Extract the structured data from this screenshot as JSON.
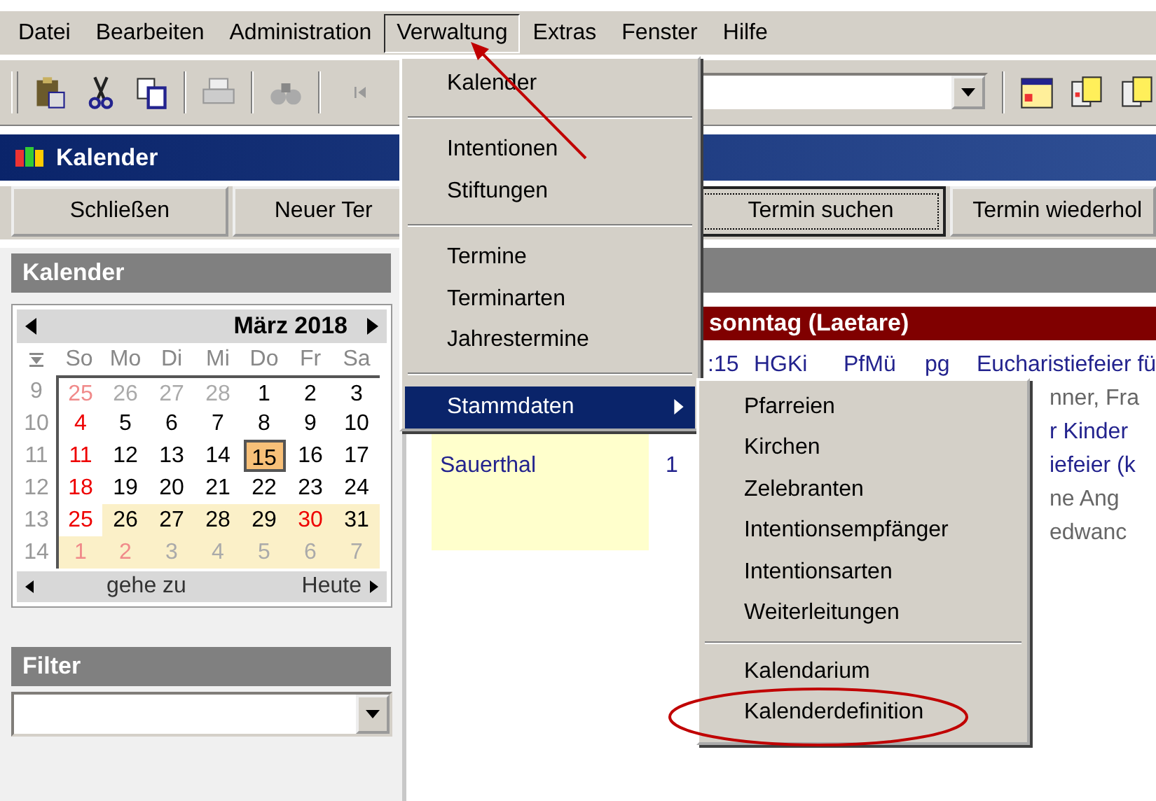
{
  "menubar": [
    {
      "label": "Datei",
      "selected": false
    },
    {
      "label": "Bearbeiten",
      "selected": false
    },
    {
      "label": "Administration",
      "selected": false
    },
    {
      "label": "Verwaltung",
      "selected": true
    },
    {
      "label": "Extras",
      "selected": false
    },
    {
      "label": "Fenster",
      "selected": false
    },
    {
      "label": "Hilfe",
      "selected": false
    }
  ],
  "window": {
    "title": "Kalender"
  },
  "buttons": [
    {
      "label": "Schließen",
      "focused": false
    },
    {
      "label": "Neuer Ter",
      "focused": false
    },
    {
      "label": "Termin suchen",
      "focused": true
    },
    {
      "label": "Termin wiederhol",
      "focused": false
    }
  ],
  "calendar_panel": {
    "title": "Kalender",
    "month": "März 2018",
    "weekdays": [
      "So",
      "Mo",
      "Di",
      "Mi",
      "Do",
      "Fr",
      "Sa"
    ],
    "weeks": [
      {
        "week": "9",
        "days": [
          {
            "text": "25",
            "kind": "sunday",
            "muted": true,
            "marked": false,
            "selected": false
          },
          {
            "text": "26",
            "kind": "weekday",
            "muted": true,
            "marked": false,
            "selected": false
          },
          {
            "text": "27",
            "kind": "weekday",
            "muted": true,
            "marked": false,
            "selected": false
          },
          {
            "text": "28",
            "kind": "weekday",
            "muted": true,
            "marked": false,
            "selected": false
          },
          {
            "text": "1",
            "kind": "weekday",
            "muted": false,
            "marked": false,
            "selected": false
          },
          {
            "text": "2",
            "kind": "weekday",
            "muted": false,
            "marked": false,
            "selected": false
          },
          {
            "text": "3",
            "kind": "weekday",
            "muted": false,
            "marked": false,
            "selected": false
          }
        ]
      },
      {
        "week": "10",
        "days": [
          {
            "text": "4",
            "kind": "sunday",
            "muted": false,
            "marked": false,
            "selected": false
          },
          {
            "text": "5",
            "kind": "weekday",
            "muted": false,
            "marked": false,
            "selected": false
          },
          {
            "text": "6",
            "kind": "weekday",
            "muted": false,
            "marked": false,
            "selected": false
          },
          {
            "text": "7",
            "kind": "weekday",
            "muted": false,
            "marked": false,
            "selected": false
          },
          {
            "text": "8",
            "kind": "weekday",
            "muted": false,
            "marked": false,
            "selected": false
          },
          {
            "text": "9",
            "kind": "weekday",
            "muted": false,
            "marked": false,
            "selected": false
          },
          {
            "text": "10",
            "kind": "weekday",
            "muted": false,
            "marked": false,
            "selected": false
          }
        ]
      },
      {
        "week": "11",
        "days": [
          {
            "text": "11",
            "kind": "sunday",
            "muted": false,
            "marked": false,
            "selected": false
          },
          {
            "text": "12",
            "kind": "weekday",
            "muted": false,
            "marked": false,
            "selected": false
          },
          {
            "text": "13",
            "kind": "weekday",
            "muted": false,
            "marked": false,
            "selected": false
          },
          {
            "text": "14",
            "kind": "weekday",
            "muted": false,
            "marked": false,
            "selected": false
          },
          {
            "text": "15",
            "kind": "weekday",
            "muted": false,
            "marked": false,
            "selected": true
          },
          {
            "text": "16",
            "kind": "weekday",
            "muted": false,
            "marked": false,
            "selected": false
          },
          {
            "text": "17",
            "kind": "weekday",
            "muted": false,
            "marked": false,
            "selected": false
          }
        ]
      },
      {
        "week": "12",
        "days": [
          {
            "text": "18",
            "kind": "sunday",
            "muted": false,
            "marked": false,
            "selected": false
          },
          {
            "text": "19",
            "kind": "weekday",
            "muted": false,
            "marked": false,
            "selected": false
          },
          {
            "text": "20",
            "kind": "weekday",
            "muted": false,
            "marked": false,
            "selected": false
          },
          {
            "text": "21",
            "kind": "weekday",
            "muted": false,
            "marked": false,
            "selected": false
          },
          {
            "text": "22",
            "kind": "weekday",
            "muted": false,
            "marked": false,
            "selected": false
          },
          {
            "text": "23",
            "kind": "weekday",
            "muted": false,
            "marked": false,
            "selected": false
          },
          {
            "text": "24",
            "kind": "weekday",
            "muted": false,
            "marked": false,
            "selected": false
          }
        ]
      },
      {
        "week": "13",
        "days": [
          {
            "text": "25",
            "kind": "sunday",
            "muted": false,
            "marked": false,
            "selected": false
          },
          {
            "text": "26",
            "kind": "weekday",
            "muted": false,
            "marked": true,
            "selected": false
          },
          {
            "text": "27",
            "kind": "weekday",
            "muted": false,
            "marked": true,
            "selected": false
          },
          {
            "text": "28",
            "kind": "weekday",
            "muted": false,
            "marked": true,
            "selected": false
          },
          {
            "text": "29",
            "kind": "weekday",
            "muted": false,
            "marked": true,
            "selected": false
          },
          {
            "text": "30",
            "kind": "holiday",
            "muted": false,
            "marked": true,
            "selected": false
          },
          {
            "text": "31",
            "kind": "weekday",
            "muted": false,
            "marked": true,
            "selected": false
          }
        ]
      },
      {
        "week": "14",
        "days": [
          {
            "text": "1",
            "kind": "sunday",
            "muted": true,
            "marked": true,
            "selected": false
          },
          {
            "text": "2",
            "kind": "holiday",
            "muted": true,
            "marked": true,
            "selected": false
          },
          {
            "text": "3",
            "kind": "weekday",
            "muted": true,
            "marked": true,
            "selected": false
          },
          {
            "text": "4",
            "kind": "weekday",
            "muted": true,
            "marked": true,
            "selected": false
          },
          {
            "text": "5",
            "kind": "weekday",
            "muted": true,
            "marked": true,
            "selected": false
          },
          {
            "text": "6",
            "kind": "weekday",
            "muted": true,
            "marked": true,
            "selected": false
          },
          {
            "text": "7",
            "kind": "weekday",
            "muted": true,
            "marked": true,
            "selected": false
          }
        ]
      }
    ],
    "goto": "gehe zu",
    "today": "Heute"
  },
  "filter": {
    "title": "Filter"
  },
  "day_header": "sonntag (Laetare)",
  "rows": [
    {
      "kind": "full",
      "time": ":15",
      "church": "HGKi",
      "celebrant": "PfMü",
      "code": "pg",
      "title": "Eucharistiefeier fü",
      "color": "#23238e"
    },
    {
      "kind": "partial",
      "title": "nner, Fra",
      "color": "#666666"
    },
    {
      "kind": "partial",
      "title": "r Kinder",
      "color": "#23238e"
    },
    {
      "kind": "partial",
      "place": "Sauerthal",
      "time": "1",
      "title": "iefeier (k",
      "color": "#23238e"
    },
    {
      "kind": "partial",
      "title": "ne Ang",
      "color": "#666666"
    },
    {
      "kind": "partial",
      "title": "edwanc",
      "color": "#666666"
    }
  ],
  "menu": {
    "items": [
      {
        "kind": "item",
        "label": "Kalender",
        "selected": false,
        "submenu": false
      },
      {
        "kind": "separator"
      },
      {
        "kind": "item",
        "label": "Intentionen",
        "selected": false,
        "submenu": false
      },
      {
        "kind": "item",
        "label": "Stiftungen",
        "selected": false,
        "submenu": false
      },
      {
        "kind": "separator"
      },
      {
        "kind": "item",
        "label": "Termine",
        "selected": false,
        "submenu": false
      },
      {
        "kind": "item",
        "label": "Terminarten",
        "selected": false,
        "submenu": false
      },
      {
        "kind": "item",
        "label": "Jahrestermine",
        "selected": false,
        "submenu": false
      },
      {
        "kind": "separator"
      },
      {
        "kind": "item",
        "label": "Stammdaten",
        "selected": true,
        "submenu": true
      }
    ]
  },
  "submenu": {
    "items": [
      {
        "kind": "item",
        "label": "Pfarreien",
        "selected": false
      },
      {
        "kind": "item",
        "label": "Kirchen",
        "selected": false
      },
      {
        "kind": "item",
        "label": "Zelebranten",
        "selected": false
      },
      {
        "kind": "item",
        "label": "Intentionsempfänger",
        "selected": false
      },
      {
        "kind": "item",
        "label": "Intentionsarten",
        "selected": false
      },
      {
        "kind": "item",
        "label": "Weiterleitungen",
        "selected": false
      },
      {
        "kind": "separator"
      },
      {
        "kind": "item",
        "label": "Kalendarium",
        "selected": false
      },
      {
        "kind": "item",
        "label": "Kalenderdefinition",
        "selected": false
      }
    ]
  }
}
